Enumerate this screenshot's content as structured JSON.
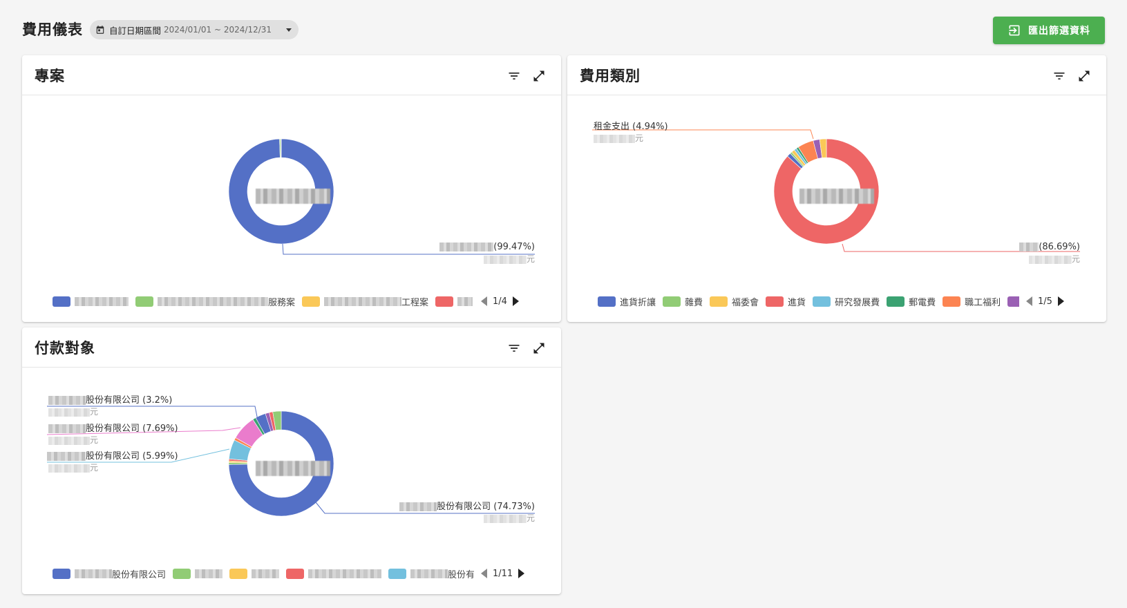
{
  "page": {
    "title": "費用儀表",
    "date_range": {
      "label": "自訂日期區間",
      "value": "2024/01/01 ~ 2024/12/31"
    },
    "export_label": "匯出篩選資料"
  },
  "colors": {
    "blue": "#5470c6",
    "green": "#91cc75",
    "yellow": "#fac858",
    "red": "#ee6666",
    "cyan": "#73c0de",
    "teal": "#3ba272",
    "orange": "#fc8452",
    "purple": "#9a60b4",
    "pink": "#ea7ccc",
    "export_green": "#4caf50"
  },
  "cards": {
    "project": {
      "title": "專案",
      "callout": {
        "pct": "(99.47%)",
        "unit": "元"
      },
      "legend": [
        "",
        "服務案",
        "工程案",
        ""
      ],
      "pager": "1/4"
    },
    "category": {
      "title": "費用類別",
      "callout_top": {
        "text": "租金支出 (4.94%)",
        "unit": "元"
      },
      "callout_bottom": {
        "pct": "(86.69%)",
        "unit": "元"
      },
      "legend": [
        "進貨折讓",
        "雜費",
        "福委會",
        "進貨",
        "研究發展費",
        "郵電費",
        "職工福利",
        ""
      ],
      "pager": "1/5"
    },
    "payee": {
      "title": "付款對象",
      "callouts": [
        {
          "text": "股份有限公司 (3.2%)",
          "unit": "元"
        },
        {
          "text": "股份有限公司 (7.69%)",
          "unit": "元"
        },
        {
          "text": "股份有限公司 (5.99%)",
          "unit": "元"
        },
        {
          "text": "股份有限公司 (74.73%)",
          "unit": "元"
        }
      ],
      "legend": [
        "股份有限公司",
        "",
        "",
        "",
        "股份有"
      ],
      "pager": "1/11"
    }
  },
  "chart_data": [
    {
      "type": "pie",
      "title": "專案",
      "donut": true,
      "slices": [
        {
          "label": "",
          "value": 99.47,
          "color": "#5470c6"
        },
        {
          "label": "服務案",
          "value": 0.35,
          "color": "#91cc75"
        },
        {
          "label": "工程案",
          "value": 0.1,
          "color": "#fac858"
        },
        {
          "label": "",
          "value": 0.08,
          "color": "#ee6666"
        }
      ]
    },
    {
      "type": "pie",
      "title": "費用類別",
      "donut": true,
      "slices": [
        {
          "label": "進貨",
          "value": 86.69,
          "color": "#ee6666"
        },
        {
          "label": "進貨折讓",
          "value": 1.2,
          "color": "#5470c6"
        },
        {
          "label": "雜費",
          "value": 0.6,
          "color": "#91cc75"
        },
        {
          "label": "福委會",
          "value": 1.0,
          "color": "#fac858"
        },
        {
          "label": "研究發展費",
          "value": 0.8,
          "color": "#73c0de"
        },
        {
          "label": "郵電費",
          "value": 0.7,
          "color": "#3ba272"
        },
        {
          "label": "租金支出",
          "value": 4.94,
          "color": "#fc8452"
        },
        {
          "label": "職工福利",
          "value": 2.0,
          "color": "#9a60b4"
        },
        {
          "label": "",
          "value": 2.07,
          "color": "#fac858"
        }
      ]
    },
    {
      "type": "pie",
      "title": "付款對象",
      "donut": true,
      "slices": [
        {
          "label": "股份有限公司",
          "value": 74.73,
          "color": "#5470c6"
        },
        {
          "label": "",
          "value": 0.6,
          "color": "#91cc75"
        },
        {
          "label": "",
          "value": 0.5,
          "color": "#fac858"
        },
        {
          "label": "",
          "value": 0.6,
          "color": "#ee6666"
        },
        {
          "label": "股份有限公司",
          "value": 5.99,
          "color": "#73c0de"
        },
        {
          "label": "",
          "value": 0.8,
          "color": "#fc8452"
        },
        {
          "label": "股份有限公司",
          "value": 7.69,
          "color": "#ea7ccc"
        },
        {
          "label": "",
          "value": 1.0,
          "color": "#3ba272"
        },
        {
          "label": "股份有限公司",
          "value": 3.2,
          "color": "#5470c6"
        },
        {
          "label": "",
          "value": 1.2,
          "color": "#9a60b4"
        },
        {
          "label": "",
          "value": 1.1,
          "color": "#ee6666"
        },
        {
          "label": "",
          "value": 2.59,
          "color": "#91cc75"
        }
      ]
    }
  ]
}
